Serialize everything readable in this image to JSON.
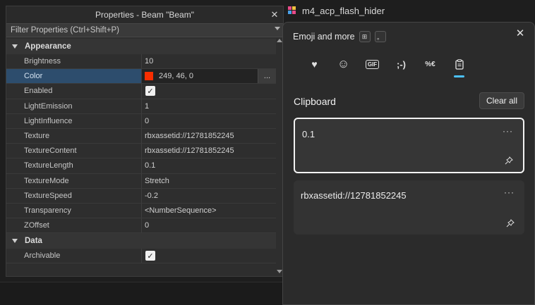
{
  "explorer": {
    "item_label": "m4_acp_flash_hider"
  },
  "properties": {
    "title": "Properties - Beam \"Beam\"",
    "close_glyph": "✕",
    "filter_placeholder": "Filter Properties (Ctrl+Shift+P)",
    "categories": [
      {
        "name": "Appearance",
        "rows": [
          {
            "name": "Brightness",
            "value": "10"
          },
          {
            "name": "Color",
            "value": "249, 46, 0",
            "swatch": "#f92e00"
          },
          {
            "name": "Enabled",
            "checked": true
          },
          {
            "name": "LightEmission",
            "value": "1"
          },
          {
            "name": "LightInfluence",
            "value": "0"
          },
          {
            "name": "Texture",
            "value": "rbxassetid://12781852245"
          },
          {
            "name": "TextureContent",
            "value": "rbxassetid://12781852245"
          },
          {
            "name": "TextureLength",
            "value": "0.1"
          },
          {
            "name": "TextureMode",
            "value": "Stretch"
          },
          {
            "name": "TextureSpeed",
            "value": "-0.2"
          },
          {
            "name": "Transparency",
            "value": "<NumberSequence>"
          },
          {
            "name": "ZOffset",
            "value": "0"
          }
        ]
      },
      {
        "name": "Data",
        "rows": [
          {
            "name": "Archivable",
            "checked": true
          }
        ]
      }
    ],
    "more_button": "..."
  },
  "emoji_panel": {
    "title": "Emoji and more",
    "win_key_glyph": "⊞",
    "period_key_glyph": "。",
    "close_glyph": "✕",
    "tabs": [
      {
        "icon": "favorites-heart-icon",
        "glyph": "♥"
      },
      {
        "icon": "smiley-icon",
        "glyph": "☺"
      },
      {
        "icon": "gif-icon",
        "glyph": "GIF"
      },
      {
        "icon": "kaomoji-icon",
        "glyph": ";-)"
      },
      {
        "icon": "symbols-icon",
        "glyph": "%€"
      },
      {
        "icon": "clipboard-icon",
        "glyph": "📋"
      }
    ],
    "active_tab": 5,
    "section_title": "Clipboard",
    "clear_all": "Clear all",
    "clips": [
      {
        "text": "0.1",
        "focused": true
      },
      {
        "text": "rbxassetid://12781852245",
        "focused": false
      }
    ],
    "dots_glyph": "···"
  },
  "colors": {
    "accent": "#4cc2ff",
    "selection": "#2d4d6d",
    "color_swatch": "#f92e00"
  }
}
